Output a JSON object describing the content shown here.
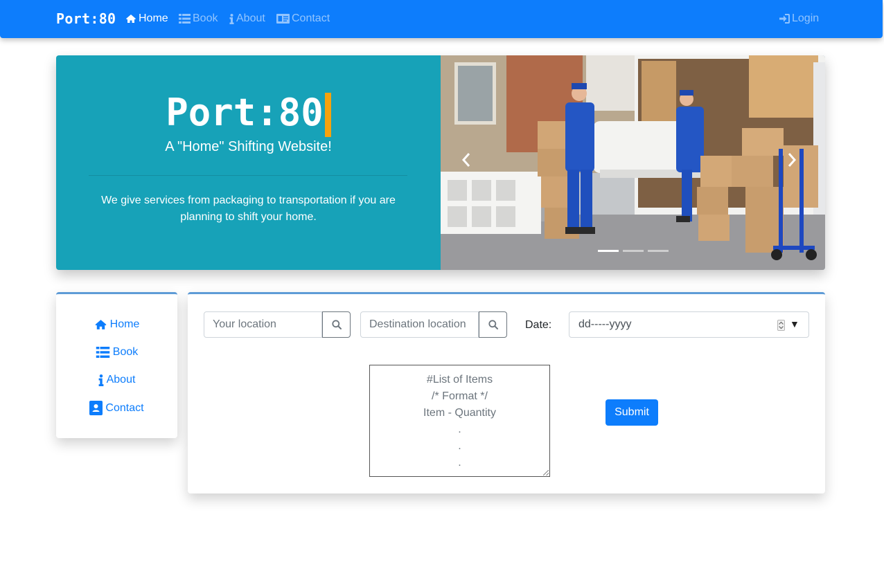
{
  "navbar": {
    "brand": "Port:80",
    "links": [
      {
        "label": "Home",
        "icon": "home-icon",
        "active": true
      },
      {
        "label": "Book",
        "icon": "list-icon",
        "active": false
      },
      {
        "label": "About",
        "icon": "info-icon",
        "active": false
      },
      {
        "label": "Contact",
        "icon": "contact-card-icon",
        "active": false
      }
    ],
    "login": {
      "label": "Login",
      "icon": "sign-in-icon"
    }
  },
  "hero": {
    "title": "Port:80",
    "subtitle": "A \"Home\" Shifting Website!",
    "description": "We give services from packaging to transportation if you are planning to shift your home.",
    "carousel": {
      "slide_count": 3,
      "active_index": 0,
      "prev_icon": "chevron-left-icon",
      "next_icon": "chevron-right-icon"
    }
  },
  "sidebar": {
    "items": [
      {
        "label": "Home",
        "icon": "home-icon"
      },
      {
        "label": "Book",
        "icon": "list-icon"
      },
      {
        "label": "About",
        "icon": "info-icon"
      },
      {
        "label": "Contact",
        "icon": "contact-card-icon"
      }
    ]
  },
  "booking": {
    "location": {
      "placeholder": "Your location",
      "value": ""
    },
    "destination": {
      "placeholder": "Destination location",
      "value": ""
    },
    "date": {
      "label": "Date:",
      "value": "dd-----yyyy"
    },
    "items": {
      "lines": [
        "#List of Items",
        "/* Format */",
        "Item - Quantity",
        ".",
        ".",
        "."
      ]
    },
    "submit_label": "Submit"
  },
  "colors": {
    "primary": "#0d7dfc",
    "hero_bg": "#17a2b8",
    "cursor": "#f7a20d",
    "card_accent": "#5e9bd6"
  }
}
